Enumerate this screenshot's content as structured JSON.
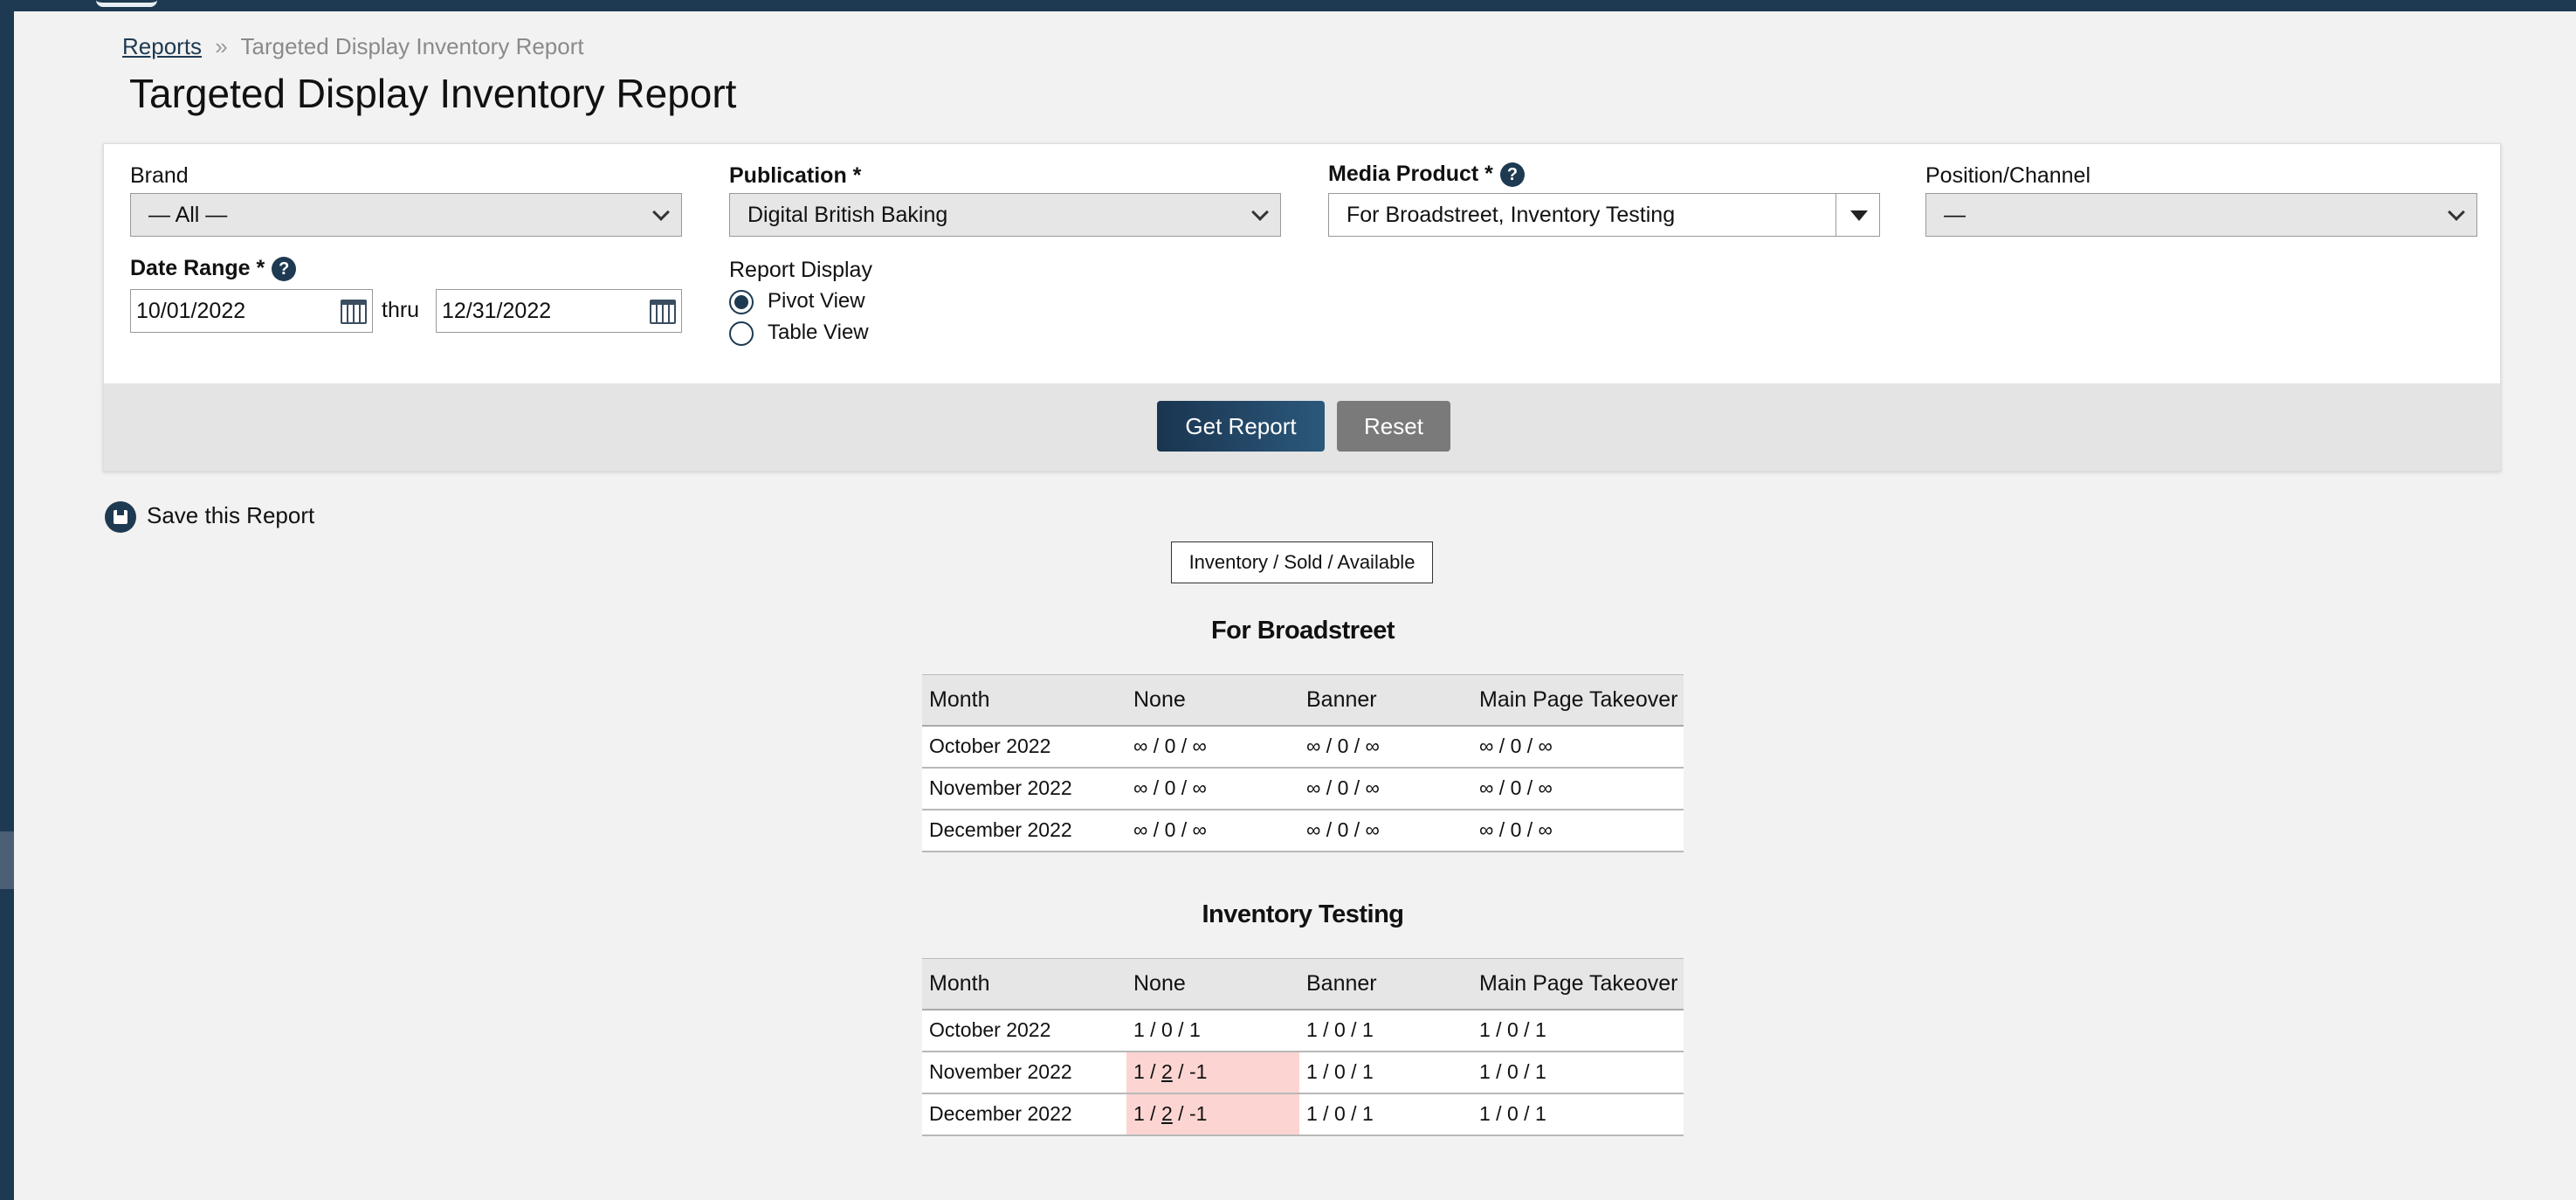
{
  "breadcrumb": {
    "parent": "Reports",
    "separator": "»",
    "current": "Targeted Display Inventory Report"
  },
  "page_title": "Targeted Display Inventory Report",
  "filters": {
    "brand": {
      "label": "Brand",
      "value": "— All —"
    },
    "publication": {
      "label": "Publication *",
      "value": "Digital British Baking"
    },
    "media_product": {
      "label": "Media Product *",
      "value": "For Broadstreet, Inventory Testing"
    },
    "position_channel": {
      "label": "Position/Channel",
      "value": "—"
    },
    "date_range": {
      "label": "Date Range *",
      "start": "10/01/2022",
      "thru": "thru",
      "end": "12/31/2022"
    },
    "report_display": {
      "label": "Report Display",
      "options": [
        {
          "label": "Pivot View",
          "selected": true
        },
        {
          "label": "Table View",
          "selected": false
        }
      ]
    }
  },
  "help_icon_text": "?",
  "actions": {
    "get_report": "Get Report",
    "reset": "Reset"
  },
  "save_report": "Save this Report",
  "legend": "Inventory / Sold / Available",
  "reports": [
    {
      "title": "For Broadstreet",
      "headers": [
        "Month",
        "None",
        "Banner",
        "Main Page Takeover"
      ],
      "rows": [
        {
          "month": "October 2022",
          "cells": [
            [
              "∞",
              "0",
              "∞"
            ],
            [
              "∞",
              "0",
              "∞"
            ],
            [
              "∞",
              "0",
              "∞"
            ]
          ]
        },
        {
          "month": "November 2022",
          "cells": [
            [
              "∞",
              "0",
              "∞"
            ],
            [
              "∞",
              "0",
              "∞"
            ],
            [
              "∞",
              "0",
              "∞"
            ]
          ]
        },
        {
          "month": "December 2022",
          "cells": [
            [
              "∞",
              "0",
              "∞"
            ],
            [
              "∞",
              "0",
              "∞"
            ],
            [
              "∞",
              "0",
              "∞"
            ]
          ]
        }
      ]
    },
    {
      "title": "Inventory Testing",
      "headers": [
        "Month",
        "None",
        "Banner",
        "Main Page Takeover"
      ],
      "rows": [
        {
          "month": "October 2022",
          "cells": [
            [
              "1",
              "0",
              "1"
            ],
            [
              "1",
              "0",
              "1"
            ],
            [
              "1",
              "0",
              "1"
            ]
          ]
        },
        {
          "month": "November 2022",
          "cells": [
            [
              "1",
              "2",
              "-1"
            ],
            [
              "1",
              "0",
              "1"
            ],
            [
              "1",
              "0",
              "1"
            ]
          ],
          "over": [
            true,
            false,
            false
          ]
        },
        {
          "month": "December 2022",
          "cells": [
            [
              "1",
              "2",
              "-1"
            ],
            [
              "1",
              "0",
              "1"
            ],
            [
              "1",
              "0",
              "1"
            ]
          ],
          "over": [
            true,
            false,
            false
          ]
        }
      ]
    }
  ]
}
